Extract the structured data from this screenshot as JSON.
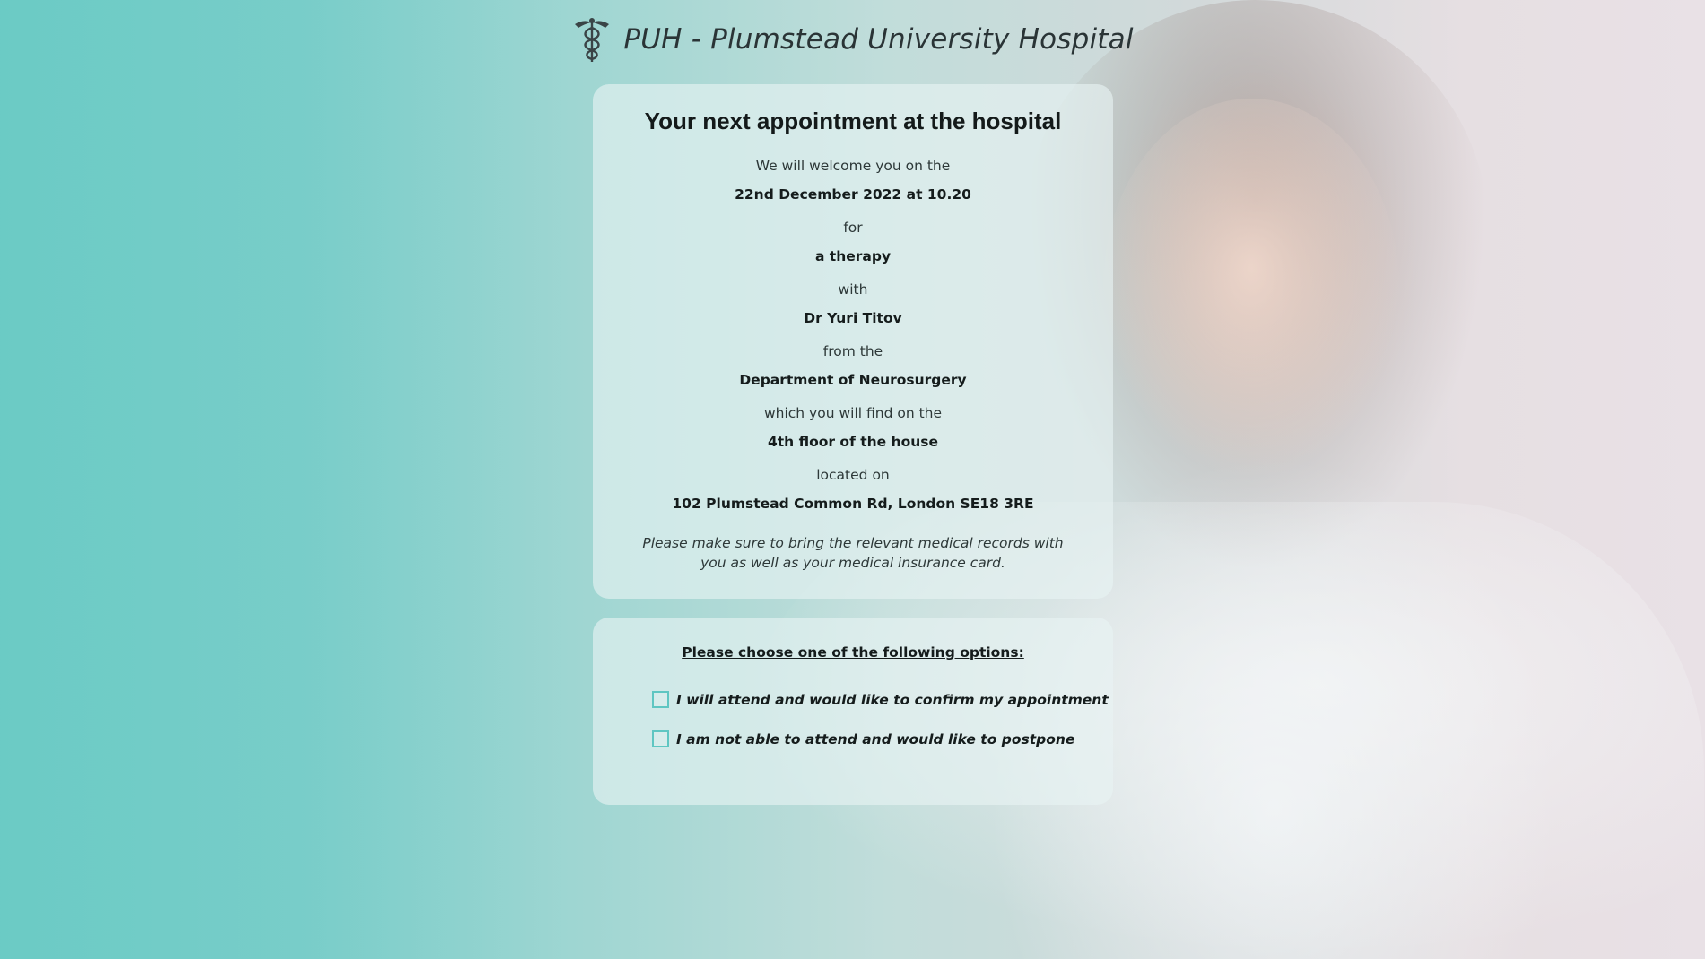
{
  "header": {
    "brand": "PUH - Plumstead University Hospital",
    "logo_icon": "caduceus-icon"
  },
  "appointment": {
    "title": "Your next appointment at the hospital",
    "welcome_text": "We will welcome you on the",
    "datetime": "22nd December 2022 at 10.20",
    "for_text": "for",
    "purpose": "a therapy",
    "with_text": "with",
    "doctor": "Dr Yuri Titov",
    "from_text": "from the",
    "department": "Department of Neurosurgery",
    "find_text": "which you will find on the",
    "floor": "4th floor of the house",
    "located_text": "located on",
    "address": "102 Plumstead Common Rd, London SE18 3RE",
    "note": "Please make sure to bring the relevant medical records with you as well as your medical insurance card."
  },
  "options": {
    "title": "Please choose one of the following options:",
    "items": [
      {
        "label": "I will attend and would like to confirm my appointment",
        "checked": false
      },
      {
        "label": "I am not able to attend and would like to postpone",
        "checked": false
      }
    ]
  },
  "colors": {
    "accent": "#5fc6c2",
    "background_teal": "#7ccfcb"
  }
}
